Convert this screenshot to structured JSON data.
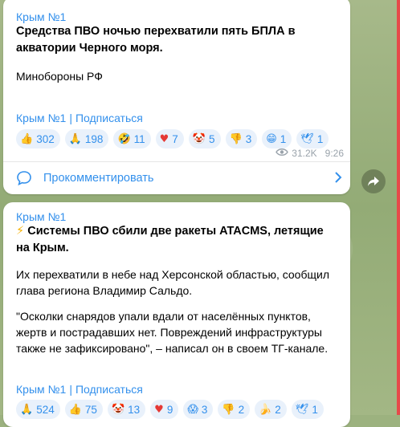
{
  "post1": {
    "channel": "Крым №1",
    "headline": "Средства ПВО ночью перехватили пять БПЛА в акватории Черного моря.",
    "source": "Минобороны РФ",
    "signature_channel": "Крым №1",
    "signature_sep": "|",
    "signature_action": "Подписаться",
    "reactions": [
      {
        "emoji": "👍",
        "count": "302"
      },
      {
        "emoji": "🙏",
        "count": "198"
      },
      {
        "emoji": "🤣",
        "count": "11"
      },
      {
        "emoji": "♥",
        "count": "7"
      },
      {
        "emoji": "🤡",
        "count": "5"
      },
      {
        "emoji": "👎",
        "count": "3"
      },
      {
        "emoji": "😁",
        "count": "1"
      },
      {
        "emoji": "🕊",
        "count": "1"
      }
    ],
    "views": "31.2K",
    "time": "9:26",
    "comment_label": "Прокомментировать"
  },
  "post2": {
    "channel": "Крым №1",
    "headline_prefix": "⚡",
    "headline": "Системы ПВО сбили две ракеты  ATACMS, летящие на Крым.",
    "paragraph1": "Их перехватили в небе над Херсонской областью, сообщил глава региона Владимир Сальдо.",
    "paragraph2": "\"Осколки снарядов упали вдали от населённых пунктов, жертв и пострадавших нет. Повреждений инфраструктуры также не зафиксировано\", – написал он в своем ТГ-канале.",
    "signature_channel": "Крым №1",
    "signature_sep": "|",
    "signature_action": "Подписаться",
    "reactions": [
      {
        "emoji": "🙏",
        "count": "524"
      },
      {
        "emoji": "👍",
        "count": "75"
      },
      {
        "emoji": "🤡",
        "count": "13"
      },
      {
        "emoji": "♥",
        "count": "9"
      },
      {
        "emoji": "😱",
        "count": "3"
      },
      {
        "emoji": "👎",
        "count": "2"
      },
      {
        "emoji": "🍌",
        "count": "2"
      },
      {
        "emoji": "🕊",
        "count": "1"
      }
    ]
  },
  "icons": {
    "views": "eye-icon",
    "comment": "comment-bubble-icon",
    "chevron": "chevron-right-icon",
    "share": "share-forward-icon"
  },
  "colors": {
    "link": "#3390ec",
    "reaction_bg": "#e9f1fb",
    "heart": "#e53935",
    "scroll_edge": "#e64a4a"
  }
}
